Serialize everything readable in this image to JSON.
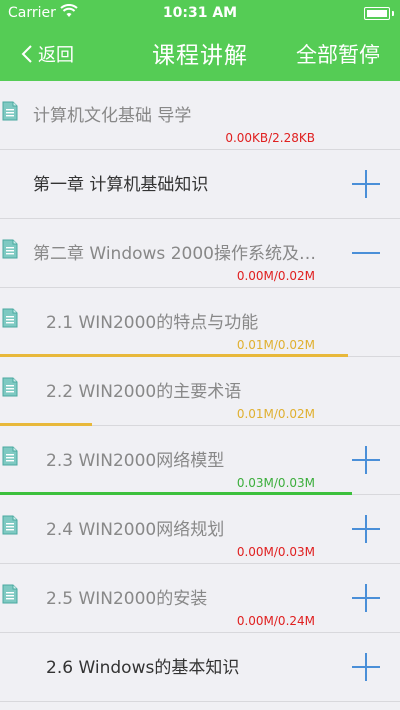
{
  "status": {
    "carrier": "Carrier",
    "time": "10:31 AM"
  },
  "nav": {
    "back": "返回",
    "title": "课程讲解",
    "pause_all": "全部暂停"
  },
  "items": [
    {
      "label": "计算机文化基础 导学",
      "size": "0.00KB/2.28KB",
      "size_color": "red",
      "icon": true,
      "action": "none",
      "progress": 0,
      "indent": false,
      "dark": false
    },
    {
      "label": "第一章 计算机基础知识",
      "size": "",
      "icon": false,
      "action": "plus",
      "progress": 0,
      "indent": false,
      "dark": true
    },
    {
      "label": "第二章 Windows 2000操作系统及…",
      "size": "0.00M/0.02M",
      "size_color": "red",
      "icon": true,
      "action": "minus",
      "progress": 0,
      "indent": false,
      "dark": false
    },
    {
      "label": "2.1 WIN2000的特点与功能",
      "size": "0.01M/0.02M",
      "size_color": "yellow",
      "icon": true,
      "action": "none",
      "progress": 0.87,
      "bar_color": "#e8b83a",
      "indent": true,
      "dark": false
    },
    {
      "label": "2.2 WIN2000的主要术语",
      "size": "0.01M/0.02M",
      "size_color": "yellow",
      "icon": true,
      "action": "none",
      "progress": 0.23,
      "bar_color": "#e8b83a",
      "indent": true,
      "dark": false
    },
    {
      "label": "2.3 WIN2000网络模型",
      "size": "0.03M/0.03M",
      "size_color": "green",
      "icon": true,
      "action": "plus",
      "progress": 0.88,
      "bar_color": "#3cc03c",
      "indent": true,
      "dark": false
    },
    {
      "label": "2.4 WIN2000网络规划",
      "size": "0.00M/0.03M",
      "size_color": "red",
      "icon": true,
      "action": "plus",
      "progress": 0,
      "indent": true,
      "dark": false
    },
    {
      "label": "2.5 WIN2000的安装",
      "size": "0.00M/0.24M",
      "size_color": "red",
      "icon": true,
      "action": "plus",
      "progress": 0,
      "indent": true,
      "dark": false
    },
    {
      "label": "2.6 Windows的基本知识",
      "size": "",
      "icon": false,
      "action": "plus",
      "progress": 0,
      "indent": true,
      "dark": true
    }
  ],
  "colors": {
    "accent_green": "#55cc55",
    "action_blue": "#4a8fd8",
    "size_red": "#e02020"
  }
}
